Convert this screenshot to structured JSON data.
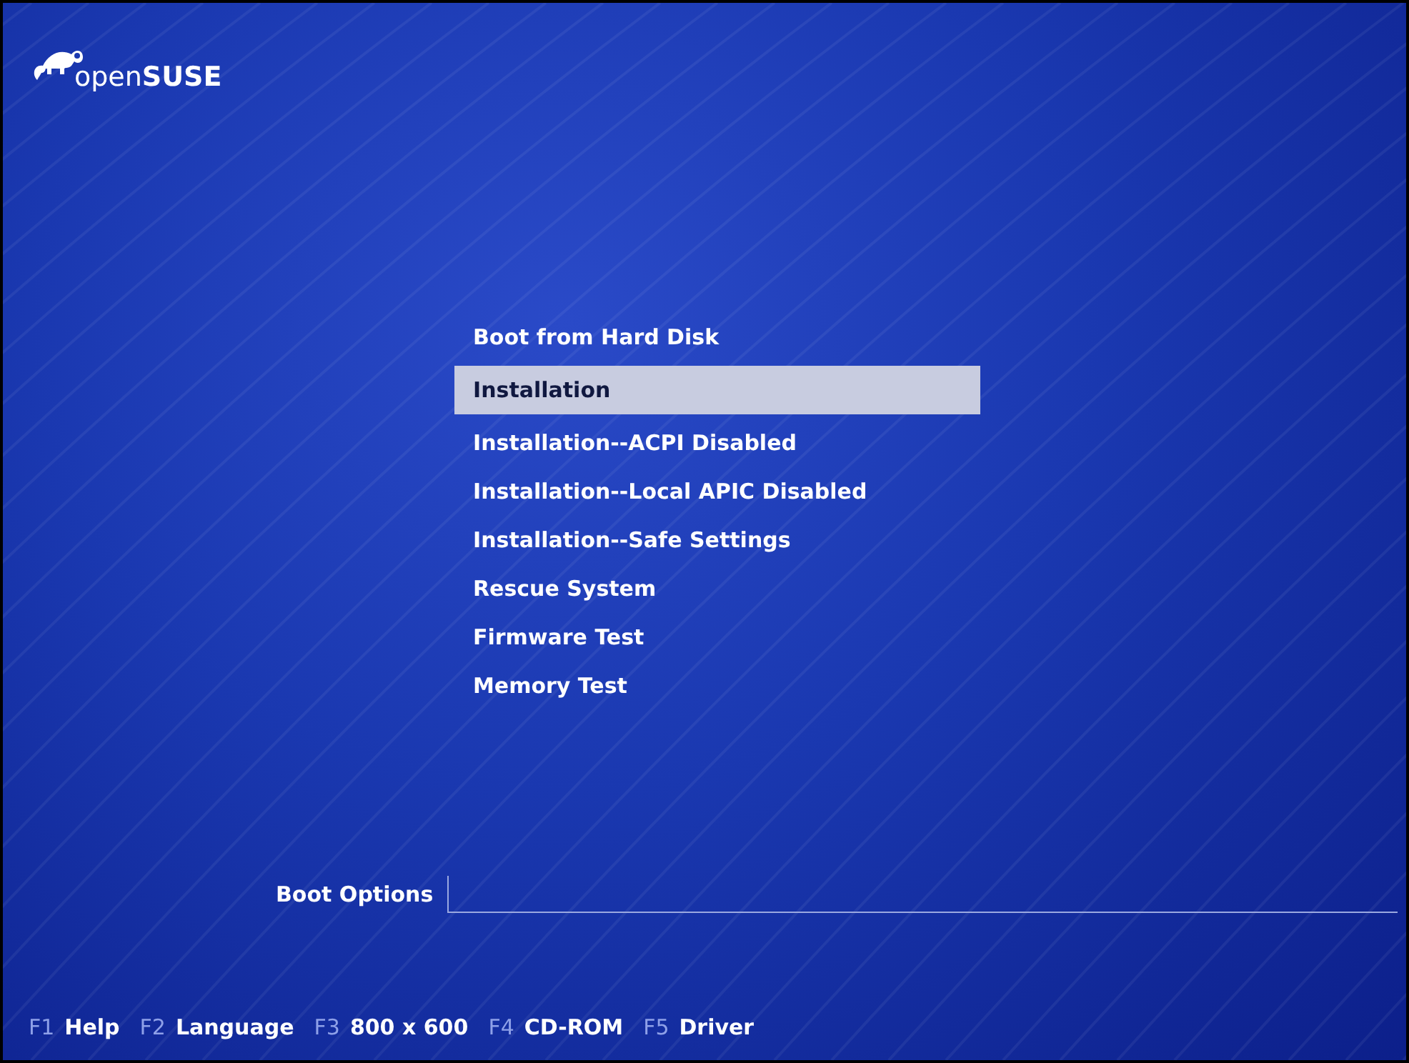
{
  "logo": {
    "text": "open**SUSE**"
  },
  "menu": [
    {
      "label": "Boot from Hard Disk",
      "selected": false
    },
    {
      "label": "Installation",
      "selected": true
    },
    {
      "label": "Installation--ACPI Disabled",
      "selected": false
    },
    {
      "label": "Installation--Local APIC Disabled",
      "selected": false
    },
    {
      "label": "Installation--Safe Settings",
      "selected": false
    },
    {
      "label": "Rescue System",
      "selected": false
    },
    {
      "label": "Firmware Test",
      "selected": false
    },
    {
      "label": "Memory Test",
      "selected": false
    }
  ],
  "boot_options": {
    "label": "Boot Options"
  },
  "function_keys": [
    {
      "key": "F1",
      "label": "Help"
    },
    {
      "key": "F2",
      "label": "Language"
    },
    {
      "key": "F3",
      "label": "800 x 600"
    },
    {
      "key": "F4",
      "label": "CD-ROM"
    },
    {
      "key": "F5",
      "label": "Driver"
    }
  ]
}
